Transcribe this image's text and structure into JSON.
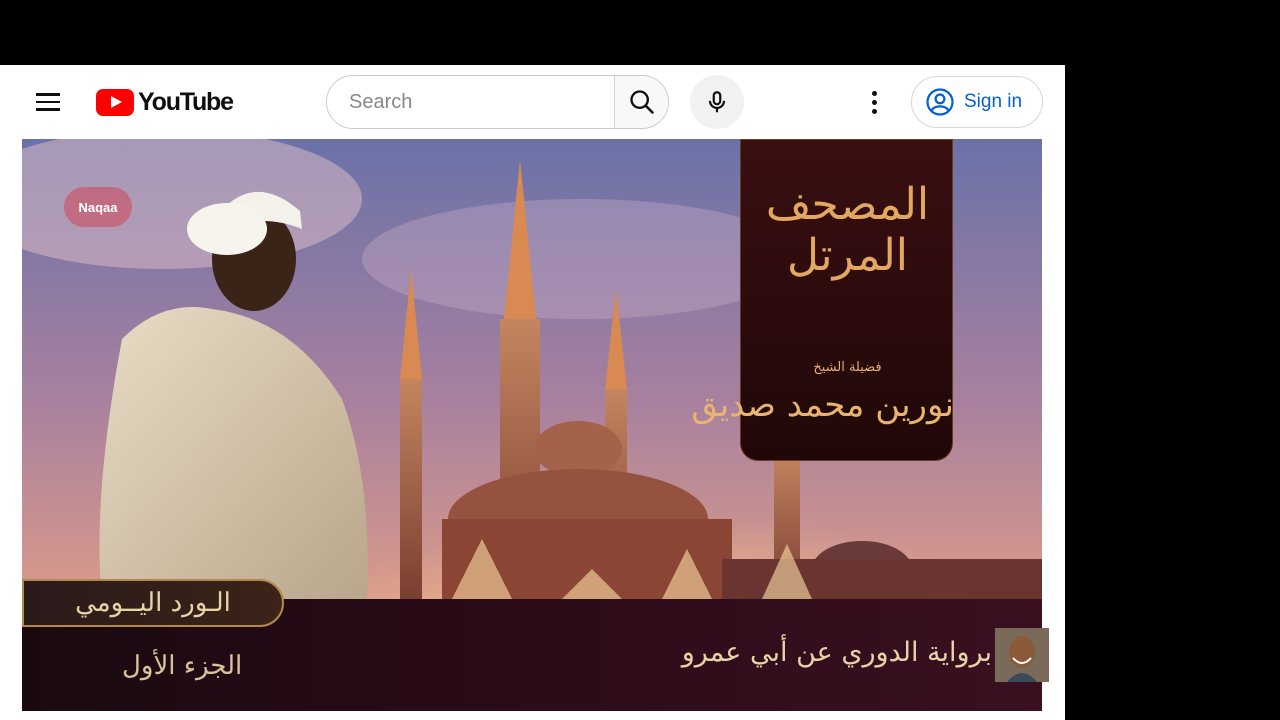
{
  "header": {
    "logo_text": "YouTube",
    "search_placeholder": "Search",
    "signin_label": "Sign in"
  },
  "icons": {
    "menu": "hamburger-menu-icon",
    "search": "magnifier-search-icon",
    "mic": "microphone-icon",
    "more": "vertical-dots-icon",
    "account": "account-circle-icon"
  },
  "colors": {
    "brand_red": "#ff0000",
    "link_blue": "#065fd4",
    "gold_text": "#e8d3a8"
  },
  "thumbnail": {
    "watermark": "Naqaa",
    "banner_title": "المصحف المرتل",
    "banner_sub": "فضيلة الشيخ",
    "banner_name": "نورين محمد صديق",
    "daily_label": "الـورد اليــومي",
    "part_label": "الجزء الأول",
    "riwaya_label": "برواية الدوري عن أبي عمرو"
  }
}
